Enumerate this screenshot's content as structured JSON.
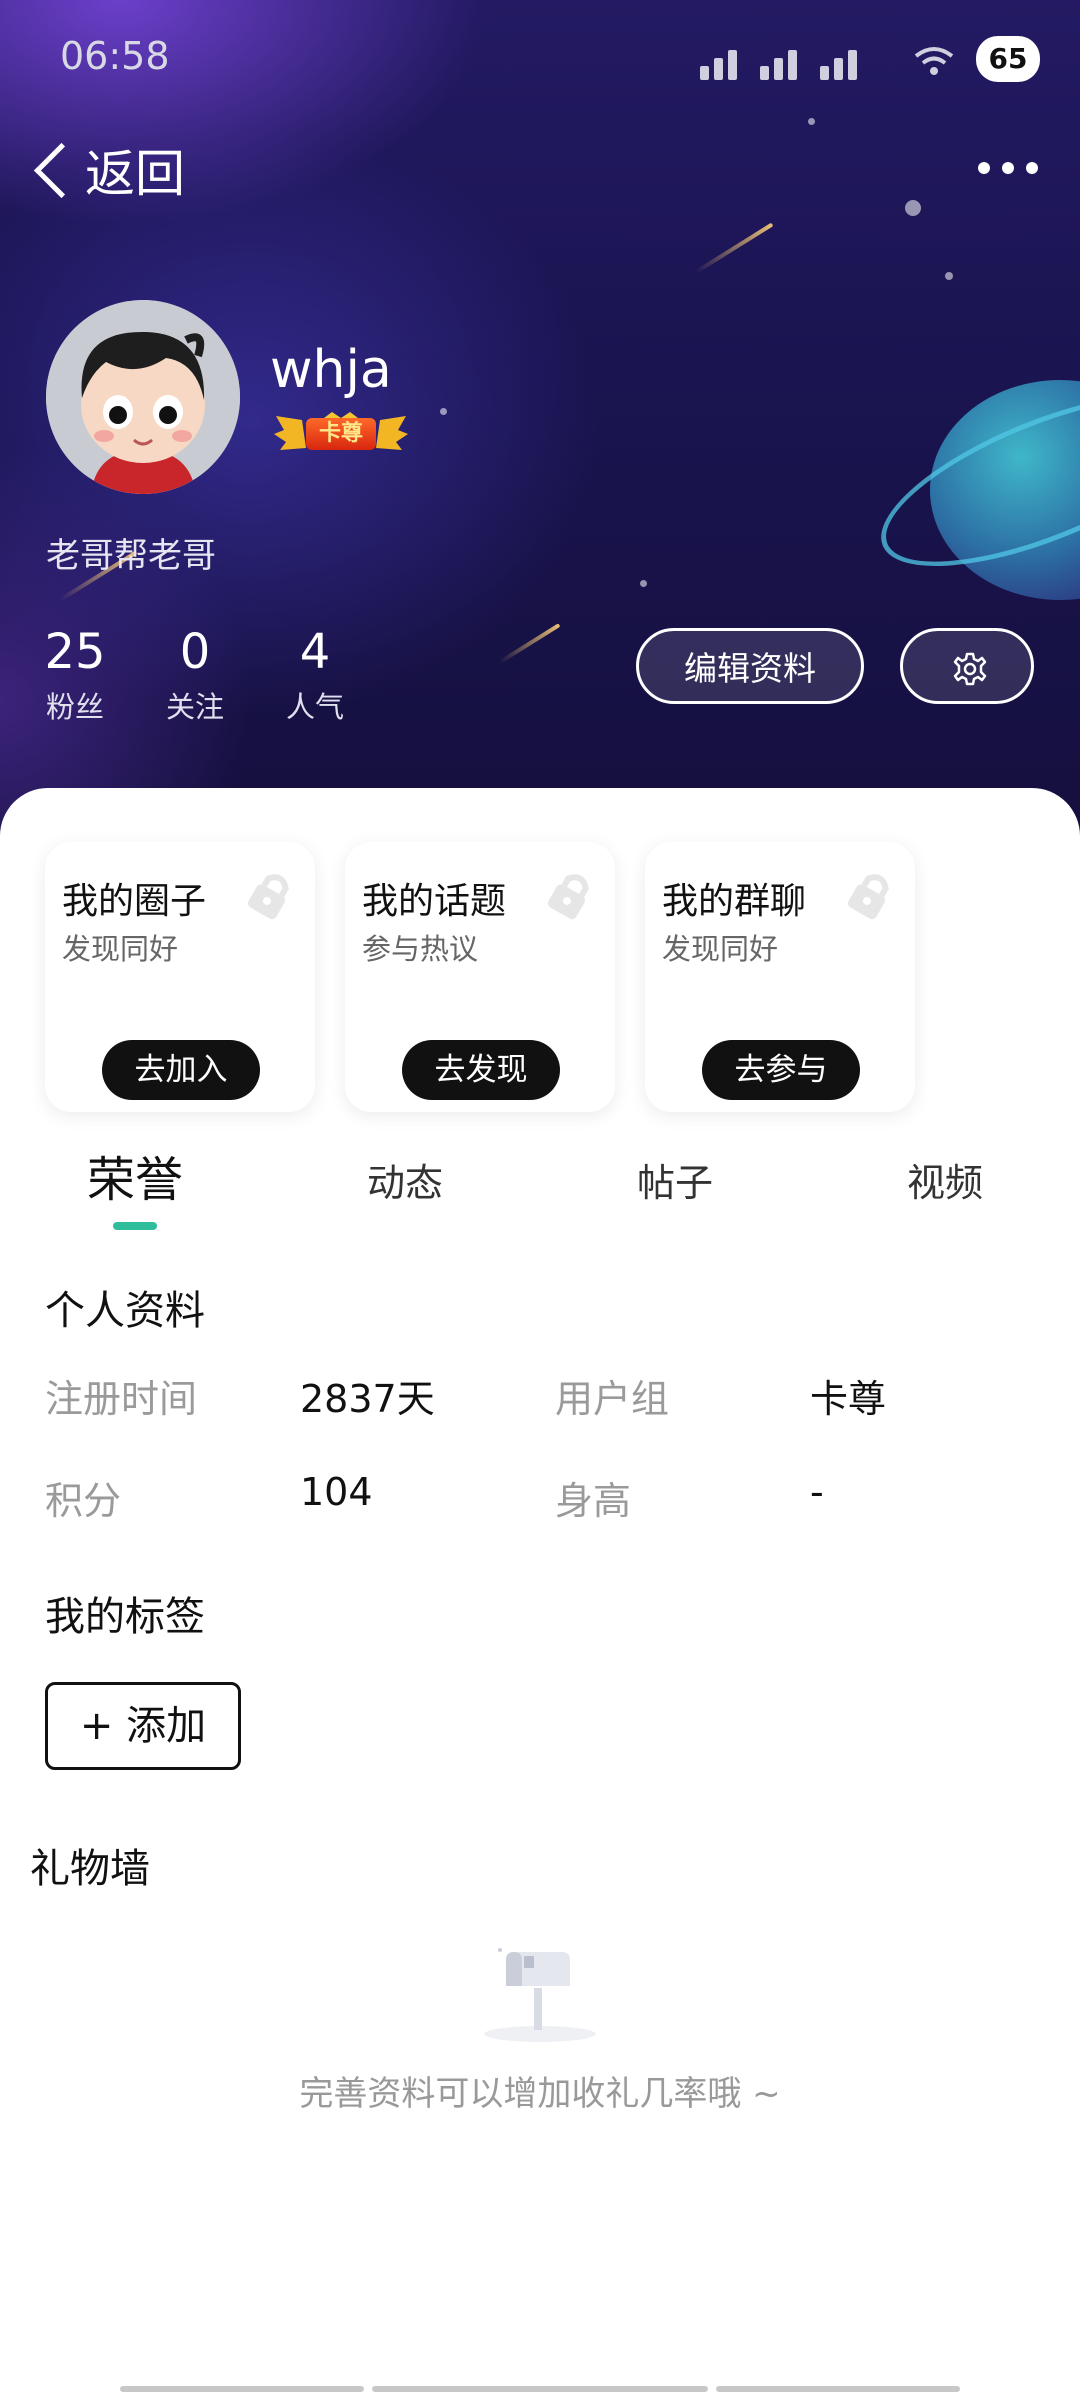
{
  "status_bar": {
    "time": "06:58",
    "battery": "65"
  },
  "nav": {
    "back_label": "返回"
  },
  "profile": {
    "username": "whja",
    "badge": "卡尊",
    "signature": "老哥帮老哥",
    "stats": [
      {
        "value": "25",
        "label": "粉丝"
      },
      {
        "value": "0",
        "label": "关注"
      },
      {
        "value": "4",
        "label": "人气"
      }
    ],
    "edit_label": "编辑资料"
  },
  "cards": [
    {
      "title": "我的圈子",
      "subtitle": "发现同好",
      "button": "去加入"
    },
    {
      "title": "我的话题",
      "subtitle": "参与热议",
      "button": "去发现"
    },
    {
      "title": "我的群聊",
      "subtitle": "发现同好",
      "button": "去参与"
    }
  ],
  "tabs": [
    "荣誉",
    "动态",
    "帖子",
    "视频"
  ],
  "personal_info": {
    "title": "个人资料",
    "fields": [
      {
        "label": "注册时间",
        "value": "2837天"
      },
      {
        "label": "用户组",
        "value": "卡尊"
      },
      {
        "label": "积分",
        "value": "104"
      },
      {
        "label": "身高",
        "value": "-"
      }
    ]
  },
  "tags": {
    "title": "我的标签",
    "add_label": "+ 添加"
  },
  "gift_wall": {
    "title": "礼物墙",
    "empty_text": "完善资料可以增加收礼几率哦 ~"
  },
  "colors": {
    "accent": "#2fbe9b",
    "header_bg": "#1a1450"
  }
}
